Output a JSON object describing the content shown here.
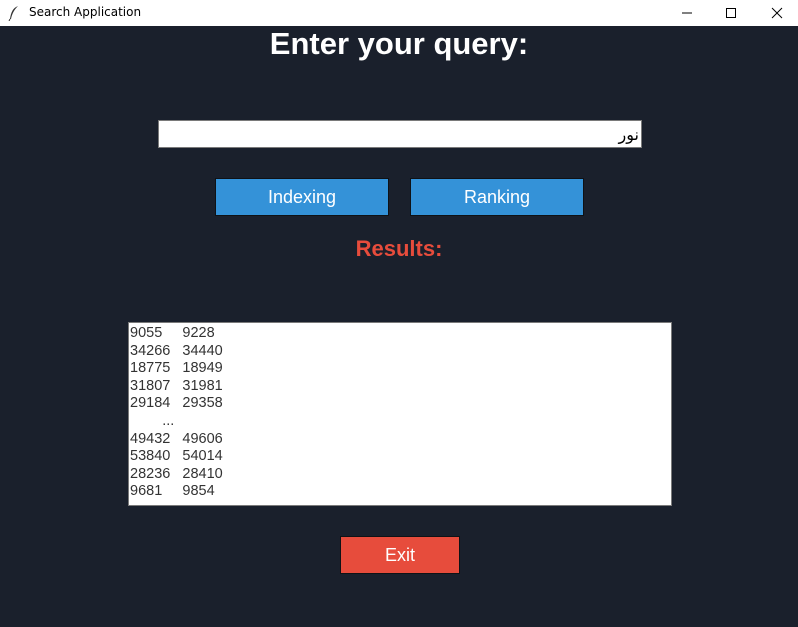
{
  "window": {
    "title": "Search Application",
    "app_icon": "feather-icon",
    "controls": [
      "minimize-icon",
      "maximize-icon",
      "close-icon"
    ]
  },
  "heading": "Enter your query:",
  "query": {
    "value": "نور"
  },
  "buttons": {
    "indexing": "Indexing",
    "ranking": "Ranking",
    "exit": "Exit"
  },
  "results": {
    "label": "Results:",
    "lines": [
      "9055     9228",
      "34266   34440",
      "18775   18949",
      "31807   31981",
      "29184   29358",
      "        ...",
      "49432   49606",
      "53840   54014",
      "28236   28410",
      "9681     9854"
    ]
  },
  "colors": {
    "background": "#1a202c",
    "primary_button": "#3492d8",
    "exit_button": "#e74c3c",
    "results_label": "#e74c3c"
  }
}
